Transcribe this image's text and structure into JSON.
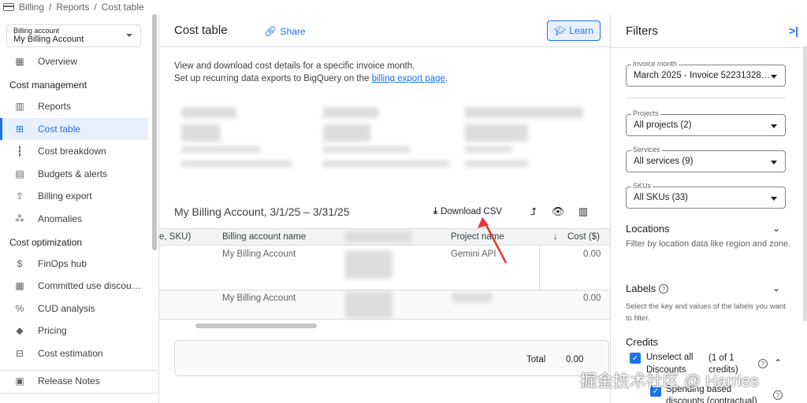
{
  "breadcrumb": [
    "Billing",
    "Reports",
    "Cost table"
  ],
  "sidebar": {
    "account_label": "Billing account",
    "account_value": "My Billing Account",
    "overview": "Overview",
    "section_cost_management": "Cost management",
    "cost_management_items": [
      "Reports",
      "Cost table",
      "Cost breakdown",
      "Budgets & alerts",
      "Billing export",
      "Anomalies"
    ],
    "section_cost_optimization": "Cost optimization",
    "cost_optimization_items": [
      "FinOps hub",
      "Committed use discou…",
      "CUD analysis",
      "Pricing",
      "Cost estimation"
    ],
    "release_notes": "Release Notes",
    "active_item": "Cost table"
  },
  "header": {
    "title": "Cost table",
    "share": "Share",
    "learn": "Learn"
  },
  "main": {
    "desc_line1": "View and download cost details for a specific invoice month.",
    "desc_line2_prefix": "Set up recurring data exports to BigQuery on the ",
    "desc_line2_link": "billing export page",
    "desc_line2_suffix": ".",
    "table_title": "My Billing Account, 3/1/25 – 3/31/25",
    "download_csv": "Download CSV",
    "columns": [
      "e, SKU)",
      "Billing account name",
      "Project name",
      "Cost ($)"
    ],
    "rows": [
      {
        "billing_account": "My Billing Account",
        "project": "Gemini API",
        "cost": "0.00"
      },
      {
        "billing_account": "My Billing Account",
        "project": "",
        "cost": "0.00"
      }
    ],
    "total_label": "Total",
    "total_value": "0.00"
  },
  "filters": {
    "title": "Filters",
    "invoice_label": "Invoice month",
    "invoice_value": "March 2025 - Invoice 52231328…",
    "projects_label": "Projects",
    "projects_value": "All projects (2)",
    "services_label": "Services",
    "services_value": "All services (9)",
    "skus_label": "SKUs",
    "skus_value": "All SKUs (33)",
    "locations_title": "Locations",
    "locations_help": "Filter by location data like region and zone.",
    "labels_title": "Labels",
    "labels_help": "Select the key and values of the labels you want to filter.",
    "credits_title": "Credits",
    "unselect_all": "Unselect all",
    "discounts": "Discounts",
    "count": "(1 of 1 credits)",
    "spending_based": "Spending based",
    "discounts_contractual": "discounts (contractual)"
  },
  "watermark": "掘金技术社区 @ Harries",
  "colors": {
    "accent": "#1a73e8",
    "active_bg": "#e8f0fe",
    "arrow": "#e53935"
  }
}
